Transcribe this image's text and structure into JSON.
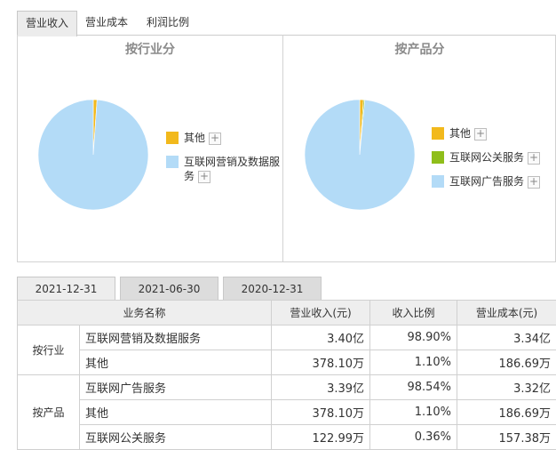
{
  "top_tabs": [
    {
      "label": "营业收入",
      "active": true
    },
    {
      "label": "营业成本",
      "active": false
    },
    {
      "label": "利润比例",
      "active": false
    }
  ],
  "chart_data": [
    {
      "type": "pie",
      "title": "按行业分",
      "legend_position": "right",
      "categories": [
        "其他",
        "互联网营销及数据服务"
      ],
      "values": [
        1.1,
        98.9
      ],
      "colors": [
        "#f2b91c",
        "#b3dbf7"
      ]
    },
    {
      "type": "pie",
      "title": "按产品分",
      "legend_position": "right",
      "categories": [
        "其他",
        "互联网公关服务",
        "互联网广告服务"
      ],
      "values": [
        1.1,
        0.36,
        98.54
      ],
      "colors": [
        "#f2b91c",
        "#8fbe1a",
        "#b3dbf7"
      ]
    }
  ],
  "legend_plus": "+",
  "date_tabs": [
    {
      "label": "2021-12-31",
      "active": true
    },
    {
      "label": "2021-06-30",
      "active": false
    },
    {
      "label": "2020-12-31",
      "active": false
    }
  ],
  "table": {
    "headers": [
      "业务名称",
      "营业收入(元)",
      "收入比例",
      "营业成本(元)"
    ],
    "groups": [
      {
        "label": "按行业",
        "rows": [
          {
            "name": "互联网营销及数据服务",
            "revenue": "3.40亿",
            "ratio": "98.90%",
            "cost": "3.34亿"
          },
          {
            "name": "其他",
            "revenue": "378.10万",
            "ratio": "1.10%",
            "cost": "186.69万"
          }
        ]
      },
      {
        "label": "按产品",
        "rows": [
          {
            "name": "互联网广告服务",
            "revenue": "3.39亿",
            "ratio": "98.54%",
            "cost": "3.32亿"
          },
          {
            "name": "其他",
            "revenue": "378.10万",
            "ratio": "1.10%",
            "cost": "186.69万"
          },
          {
            "name": "互联网公关服务",
            "revenue": "122.99万",
            "ratio": "0.36%",
            "cost": "157.38万"
          }
        ]
      }
    ]
  }
}
